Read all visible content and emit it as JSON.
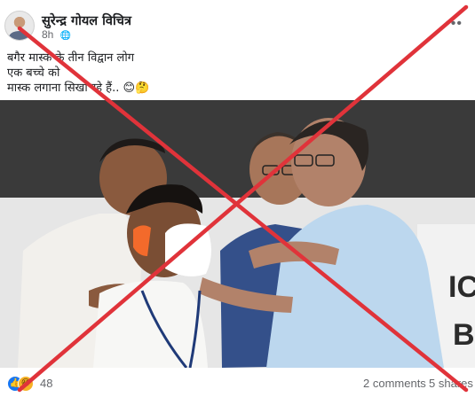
{
  "post": {
    "author": "सुरेन्द्र गोयल विचित्र",
    "time": "8h",
    "caption_lines": [
      "बगैर मास्क के तीन विद्वान लोग",
      "एक बच्चे को",
      "मास्क लगाना सिखा रहे हैं.."
    ],
    "caption_emoji": "😊🤔"
  },
  "photo": {
    "sign_letters": "IC\nB"
  },
  "footer": {
    "reaction_count": "48",
    "comments": "2 comments",
    "shares": "5 shares"
  },
  "icons": {
    "globe": "globe-icon",
    "more": "more-options-icon",
    "like": "like-reaction-icon",
    "haha": "haha-reaction-icon"
  },
  "colors": {
    "cross": "#e0333a",
    "like": "#1877f2",
    "haha": "#f7b125",
    "muted_text": "#65676b"
  }
}
